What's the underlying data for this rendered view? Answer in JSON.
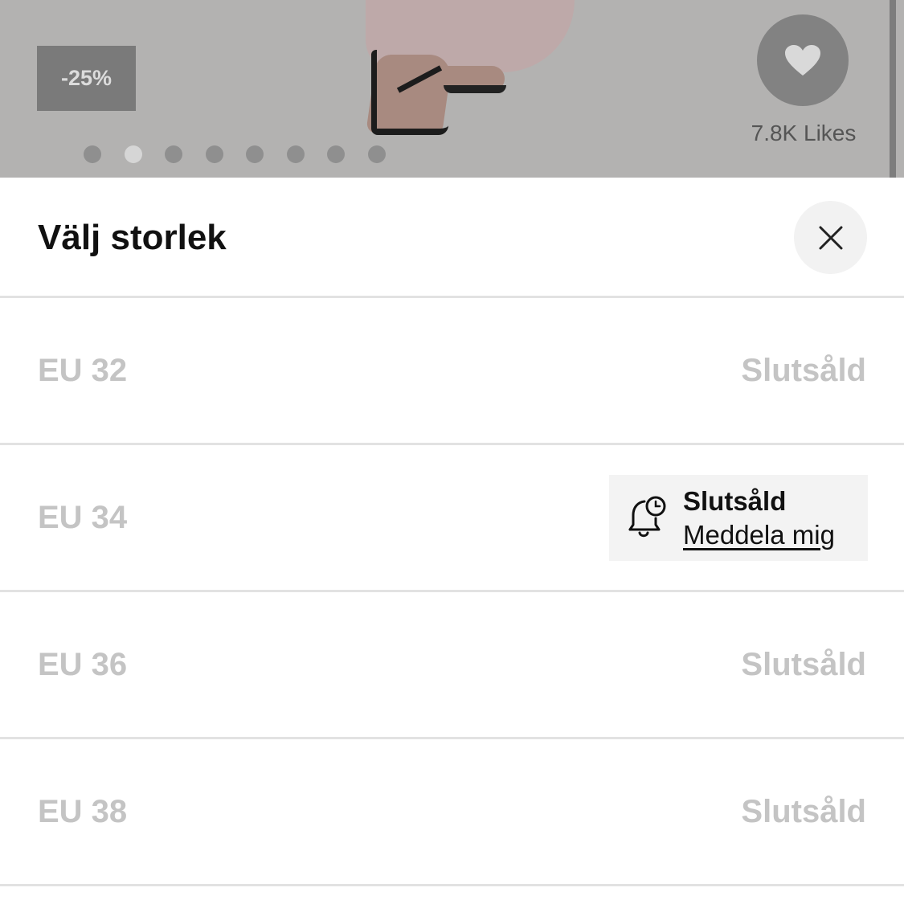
{
  "product_image": {
    "discount_badge": "-25%",
    "carousel": {
      "count": 8,
      "active_index": 1
    },
    "likes_label": "7.8K Likes",
    "icon": "heart-icon"
  },
  "size_sheet": {
    "title": "Välj storlek",
    "close_icon": "close-icon",
    "sizes": [
      {
        "label": "EU 32",
        "status": "Slutsåld"
      },
      {
        "label": "EU 34",
        "status": "Slutsåld",
        "notify_label": "Meddela mig",
        "notify_icon": "bell-clock-icon"
      },
      {
        "label": "EU 36",
        "status": "Slutsåld"
      },
      {
        "label": "EU 38",
        "status": "Slutsåld"
      }
    ]
  }
}
